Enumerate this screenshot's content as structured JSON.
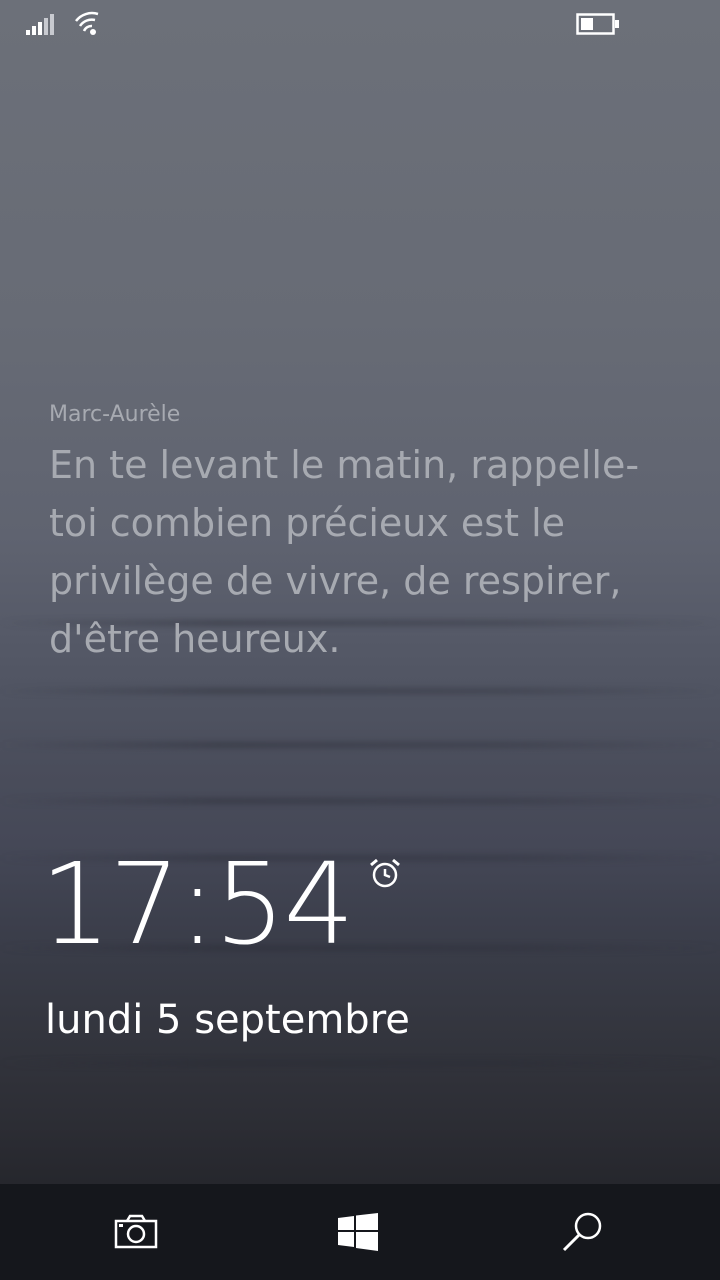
{
  "status_bar": {
    "signal_icon": "signal-bars-icon",
    "wifi_icon": "wifi-icon",
    "battery_icon": "battery-icon",
    "battery_level": 0.4
  },
  "quote": {
    "author": "Marc-Aurèle",
    "text": "En te levant le matin, rappelle-\ntoi combien précieux est le\nprivilège de vivre, de respirer,\nd'être heureux."
  },
  "lock": {
    "time": "17:54",
    "date": "lundi 5 septembre",
    "alarm_icon": "alarm-clock-icon"
  },
  "nav": {
    "camera_icon": "camera-icon",
    "start_icon": "windows-start-icon",
    "search_icon": "search-icon"
  },
  "colors": {
    "nav_bg": "#15171c",
    "quote_text": "#a7aab1",
    "clock_text": "#ffffff"
  }
}
